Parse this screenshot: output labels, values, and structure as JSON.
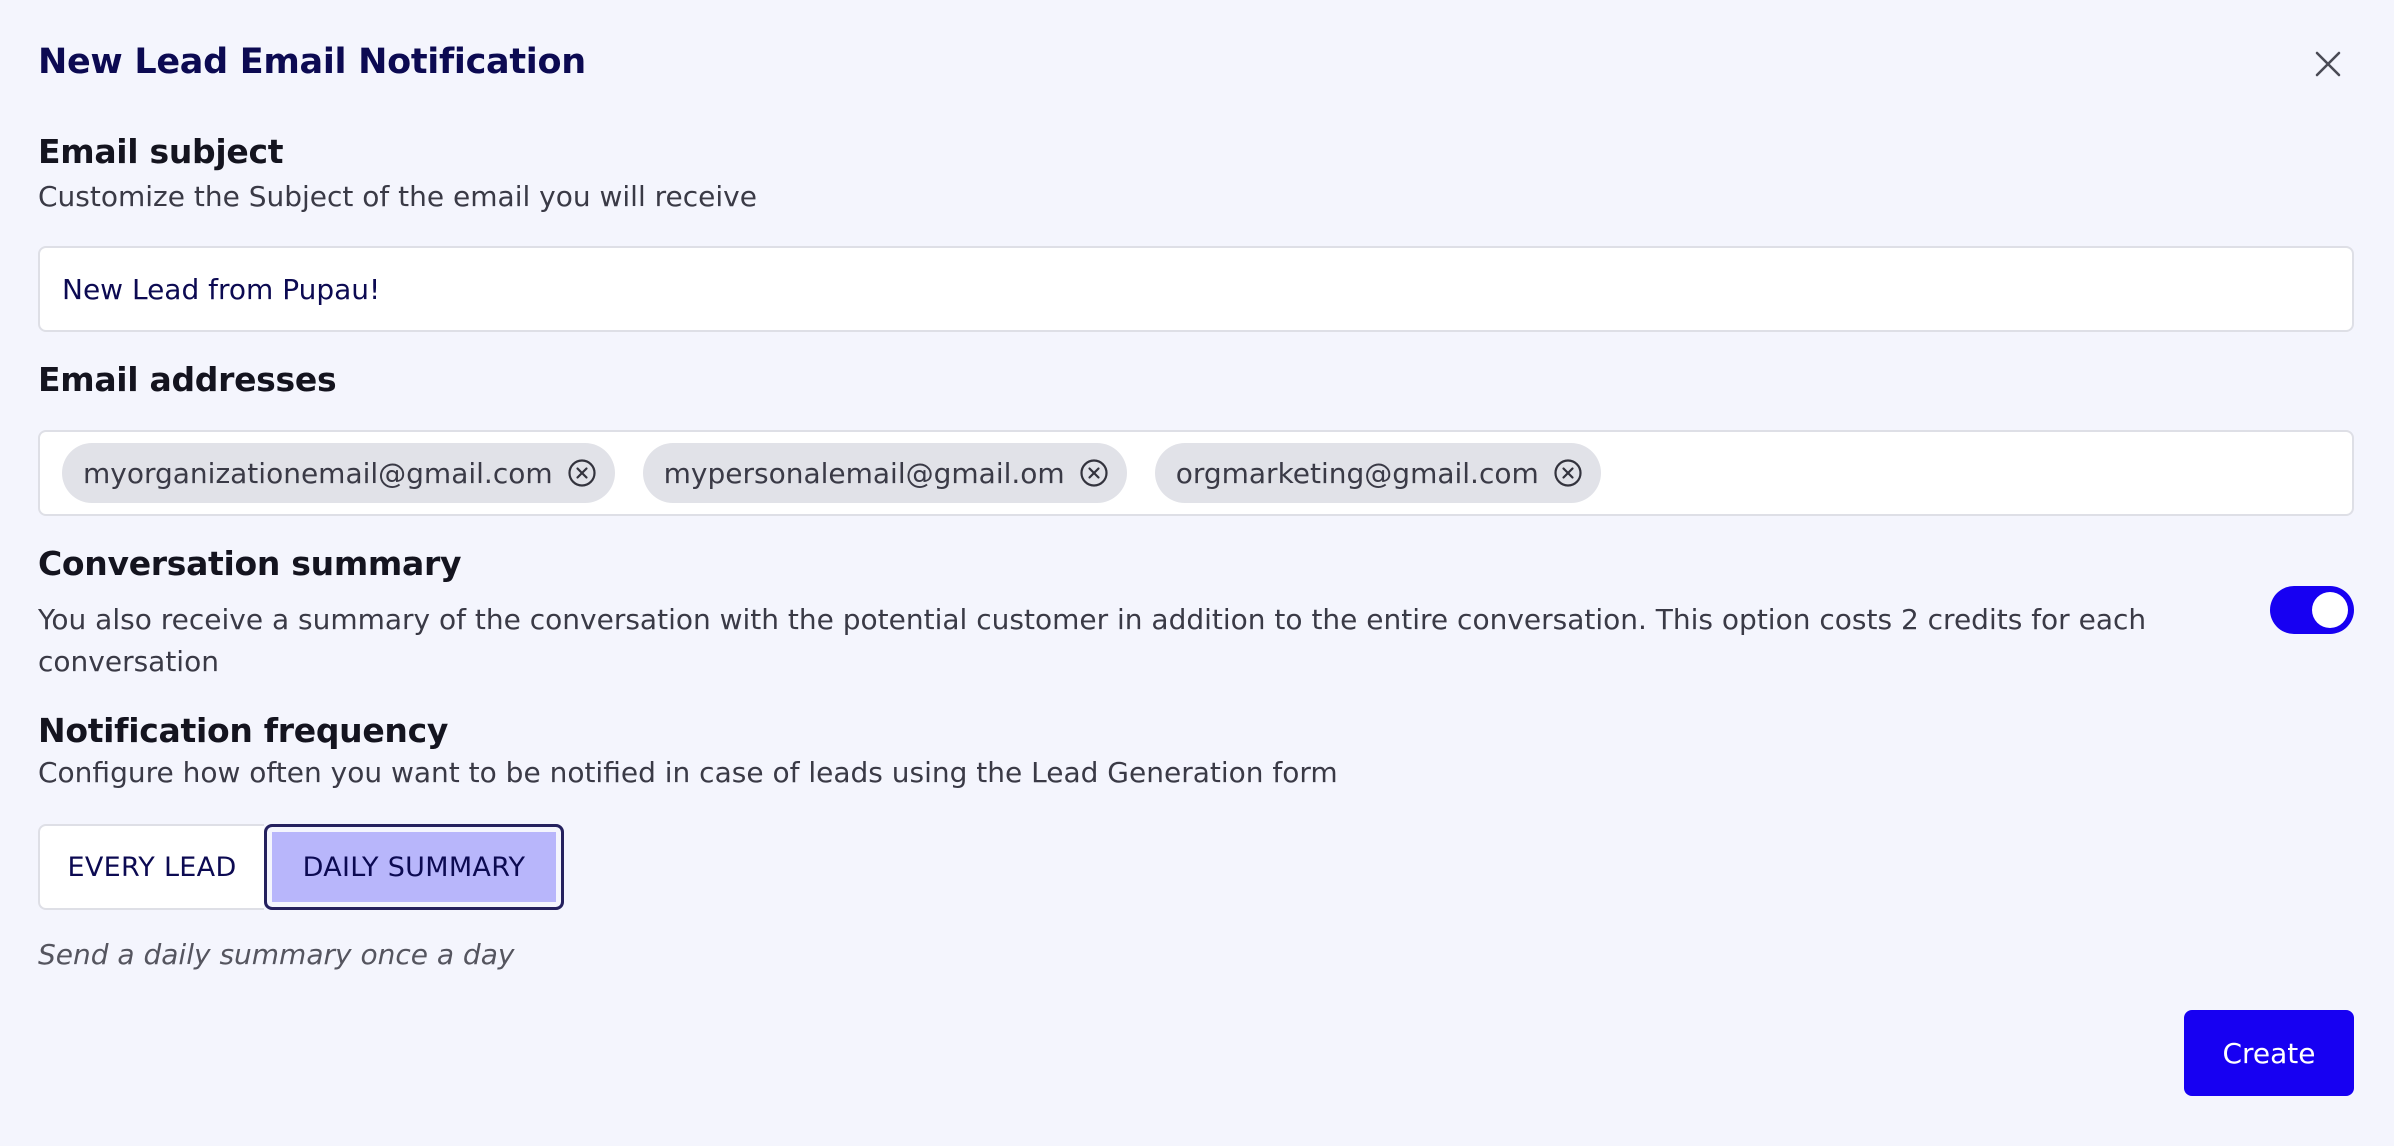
{
  "dialog": {
    "title": "New Lead Email Notification",
    "close_icon": "close-icon"
  },
  "subject": {
    "title": "Email subject",
    "description": "Customize the Subject of the email you will receive",
    "value": "New Lead from Pupau!"
  },
  "addresses": {
    "title": "Email addresses",
    "chips": [
      "myorganizationemail@gmail.com",
      "mypersonalemail@gmail.om",
      "orgmarketing@gmail.com"
    ],
    "remove_icon": "circle-x-icon"
  },
  "summary": {
    "title": "Conversation summary",
    "description": "You also receive a summary of the conversation with the potential customer in addition to the entire conversation. This option costs 2 credits for each conversation",
    "enabled": true
  },
  "frequency": {
    "title": "Notification frequency",
    "description": "Configure how often you want to be notified in case of leads using the Lead Generation form",
    "options": [
      "EVERY LEAD",
      "DAILY SUMMARY"
    ],
    "selected": "DAILY SUMMARY",
    "hint": "Send a daily summary once a day"
  },
  "actions": {
    "create_label": "Create"
  },
  "colors": {
    "accent": "#1700f2",
    "selected_segment": "#b8b6fb",
    "title": "#0c0a52",
    "background": "#f4f5fd"
  }
}
